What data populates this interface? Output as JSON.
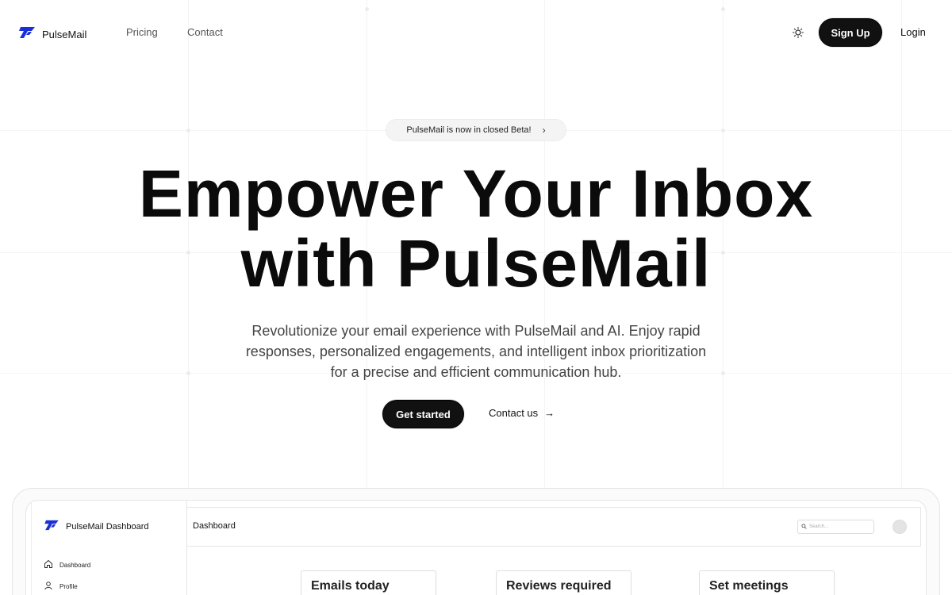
{
  "nav": {
    "brand": "PulseMail",
    "links": [
      "Pricing",
      "Contact"
    ],
    "signup": "Sign Up",
    "login": "Login",
    "theme_icon": "sun-icon"
  },
  "hero": {
    "badge": "PulseMail is now in closed Beta!",
    "title_line1": "Empower Your Inbox",
    "title_line2": "with PulseMail",
    "subtitle": "Revolutionize your email experience with PulseMail and AI. Enjoy rapid responses, personalized engagements, and intelligent inbox prioritization for a precise and efficient communication hub.",
    "primary_cta": "Get started",
    "secondary_cta": "Contact us"
  },
  "dashboard_preview": {
    "brand": "PulseMail Dashboard",
    "header_title": "Dashboard",
    "search_placeholder": "Search...",
    "sidebar_items": [
      {
        "label": "Dashboard",
        "icon": "home-icon"
      },
      {
        "label": "Profile",
        "icon": "user-icon"
      }
    ],
    "cards": [
      "Emails today",
      "Reviews required",
      "Set meetings"
    ]
  },
  "colors": {
    "brand_blue": "#1b2fd6",
    "primary_button": "#111111",
    "text": "#0b0b0b",
    "muted_text": "#444444"
  }
}
